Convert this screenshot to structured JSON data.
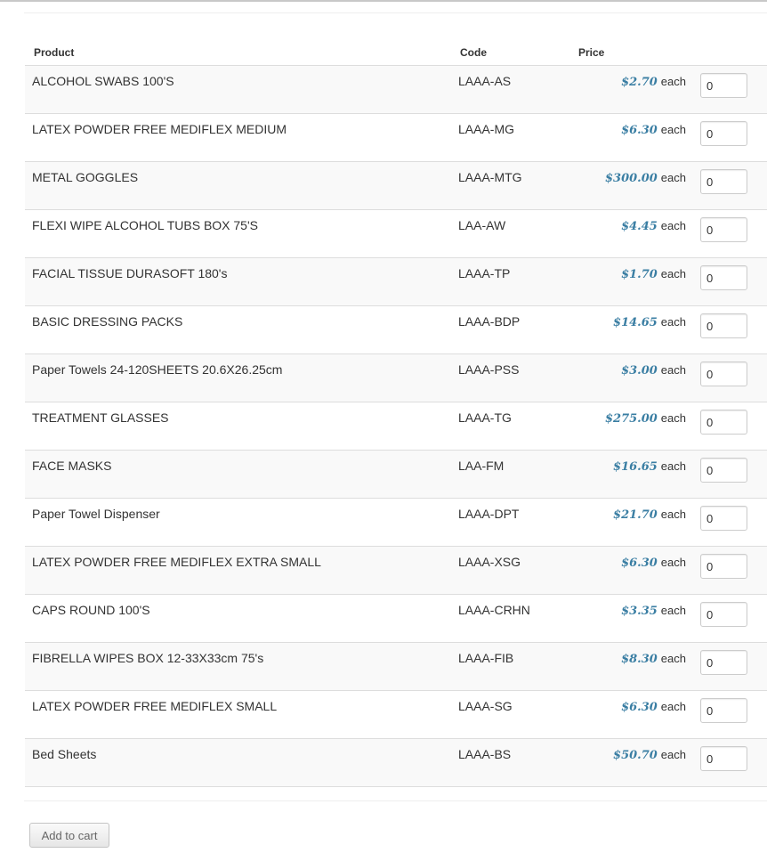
{
  "table": {
    "headers": {
      "product": "Product",
      "code": "Code",
      "price": "Price"
    },
    "rows": [
      {
        "name": "ALCOHOL SWABS 100'S",
        "code": "LAAA-AS",
        "price": "$2.70",
        "unit": "each",
        "qty": "0"
      },
      {
        "name": "LATEX POWDER FREE MEDIFLEX MEDIUM",
        "code": "LAAA-MG",
        "price": "$6.30",
        "unit": "each",
        "qty": "0"
      },
      {
        "name": "METAL GOGGLES",
        "code": "LAAA-MTG",
        "price": "$300.00",
        "unit": "each",
        "qty": "0"
      },
      {
        "name": "FLEXI WIPE ALCOHOL TUBS BOX 75'S",
        "code": "LAA-AW",
        "price": "$4.45",
        "unit": "each",
        "qty": "0"
      },
      {
        "name": "FACIAL TISSUE DURASOFT 180's",
        "code": "LAAA-TP",
        "price": "$1.70",
        "unit": "each",
        "qty": "0"
      },
      {
        "name": "BASIC DRESSING PACKS",
        "code": "LAAA-BDP",
        "price": "$14.65",
        "unit": "each",
        "qty": "0"
      },
      {
        "name": "Paper Towels 24-120SHEETS 20.6X26.25cm",
        "code": "LAAA-PSS",
        "price": "$3.00",
        "unit": "each",
        "qty": "0"
      },
      {
        "name": "TREATMENT GLASSES",
        "code": "LAAA-TG",
        "price": "$275.00",
        "unit": "each",
        "qty": "0"
      },
      {
        "name": "FACE MASKS",
        "code": "LAA-FM",
        "price": "$16.65",
        "unit": "each",
        "qty": "0"
      },
      {
        "name": "Paper Towel Dispenser",
        "code": "LAAA-DPT",
        "price": "$21.70",
        "unit": "each",
        "qty": "0"
      },
      {
        "name": "LATEX POWDER FREE MEDIFLEX EXTRA SMALL",
        "code": "LAAA-XSG",
        "price": "$6.30",
        "unit": "each",
        "qty": "0"
      },
      {
        "name": "CAPS ROUND 100'S",
        "code": "LAAA-CRHN",
        "price": "$3.35",
        "unit": "each",
        "qty": "0"
      },
      {
        "name": "FIBRELLA WIPES BOX 12-33X33cm 75's",
        "code": "LAAA-FIB",
        "price": "$8.30",
        "unit": "each",
        "qty": "0"
      },
      {
        "name": "LATEX POWDER FREE MEDIFLEX SMALL",
        "code": "LAAA-SG",
        "price": "$6.30",
        "unit": "each",
        "qty": "0"
      },
      {
        "name": "Bed Sheets",
        "code": "LAAA-BS",
        "price": "$50.70",
        "unit": "each",
        "qty": "0"
      }
    ]
  },
  "actions": {
    "add_to_cart": "Add to cart"
  },
  "colors": {
    "price": "#3a7ea3",
    "row_stripe": "#f9f9f9",
    "border": "#dddddd"
  }
}
